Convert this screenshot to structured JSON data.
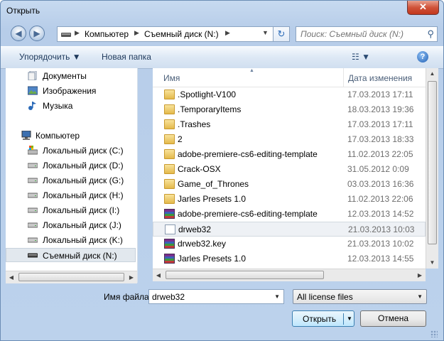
{
  "window": {
    "title": "Открыть",
    "close_glyph": "✕"
  },
  "nav": {
    "back_glyph": "◀",
    "forward_glyph": "▶",
    "breadcrumb": [
      "Компьютер",
      "Съемный диск (N:)"
    ],
    "sep_glyph": "▶",
    "dropdown_glyph": "▼",
    "refresh_glyph": "↻",
    "search_placeholder": "Поиск: Съемный диск (N:)",
    "search_icon_glyph": "⚲"
  },
  "toolbar": {
    "organize_label": "Упорядочить ▼",
    "new_folder_label": "Новая папка",
    "view_glyph": "☷ ▼",
    "help_glyph": "?"
  },
  "sidebar": {
    "items": [
      {
        "label": "Документы",
        "icon": "documents-icon"
      },
      {
        "label": "Изображения",
        "icon": "pictures-icon"
      },
      {
        "label": "Музыка",
        "icon": "music-icon"
      },
      {
        "label": "Компьютер",
        "icon": "computer-icon"
      },
      {
        "label": "Локальный диск (C:)",
        "icon": "system-drive-icon"
      },
      {
        "label": "Локальный диск (D:)",
        "icon": "drive-icon"
      },
      {
        "label": "Локальный диск (G:)",
        "icon": "drive-icon"
      },
      {
        "label": "Локальный диск (H:)",
        "icon": "drive-icon"
      },
      {
        "label": "Локальный диск (I:)",
        "icon": "drive-icon"
      },
      {
        "label": "Локальный диск (J:)",
        "icon": "drive-icon"
      },
      {
        "label": "Локальный диск (K:)",
        "icon": "drive-icon"
      },
      {
        "label": "Съемный диск (N:)",
        "icon": "removable-drive-icon"
      }
    ],
    "selected": "Съемный диск (N:)"
  },
  "files": {
    "col_name": "Имя",
    "col_date": "Дата изменения",
    "rows": [
      {
        "name": ".Spotlight-V100",
        "date": "17.03.2013 17:11",
        "kind": "folder"
      },
      {
        "name": ".TemporaryItems",
        "date": "18.03.2013 19:36",
        "kind": "folder"
      },
      {
        "name": ".Trashes",
        "date": "17.03.2013 17:11",
        "kind": "folder"
      },
      {
        "name": "2",
        "date": "17.03.2013 18:33",
        "kind": "folder"
      },
      {
        "name": "adobe-premiere-cs6-editing-template",
        "date": "11.02.2013 22:05",
        "kind": "folder"
      },
      {
        "name": "Crack-OSX",
        "date": "31.05.2012 0:09",
        "kind": "folder"
      },
      {
        "name": "Game_of_Thrones",
        "date": "03.03.2013 16:36",
        "kind": "folder"
      },
      {
        "name": "Jarles Presets 1.0",
        "date": "11.02.2013 22:06",
        "kind": "folder"
      },
      {
        "name": "adobe-premiere-cs6-editing-template",
        "date": "12.03.2013 14:52",
        "kind": "archive"
      },
      {
        "name": "drweb32",
        "date": "21.03.2013 10:03",
        "kind": "document"
      },
      {
        "name": "drweb32.key",
        "date": "21.03.2013 10:02",
        "kind": "archive"
      },
      {
        "name": "Jarles Presets 1.0",
        "date": "12.03.2013 14:55",
        "kind": "archive"
      }
    ],
    "selected": "drweb32"
  },
  "bottom": {
    "filename_label": "Имя файла:",
    "filename_value": "drweb32",
    "filter_value": "All license files",
    "open_label": "Открыть",
    "cancel_label": "Отмена",
    "dropdown_glyph": "▼"
  }
}
